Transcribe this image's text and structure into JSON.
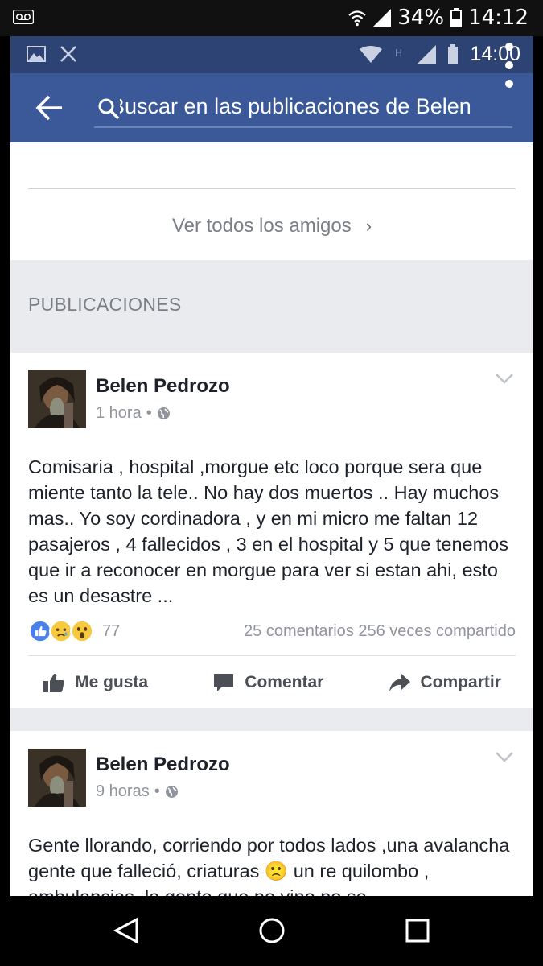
{
  "outer_status": {
    "battery": "34%",
    "time": "14:12"
  },
  "inner_status": {
    "time": "14:00"
  },
  "search": {
    "text": "Buscar en las publicaciones de Belen"
  },
  "friends": {
    "see_all": "Ver todos los amigos"
  },
  "section": {
    "title": "PUBLICACIONES"
  },
  "posts": [
    {
      "author": "Belen Pedrozo",
      "time": "1 hora",
      "separator": "•",
      "text": "Comisaria , hospital ,morgue etc loco porque sera que miente tanto la tele.. No hay dos muertos .. Hay muchos mas.. Yo soy cordinadora , y en mi micro me faltan 12 pasajeros , 4 fallecidos ,  3 en el hospital  y 5 que tenemos que ir a reconocer en morgue para ver si estan ahi, esto es un desastre ...",
      "reactions_count": "77",
      "comments": "25 comentarios",
      "shares": "256 veces compartido"
    },
    {
      "author": "Belen Pedrozo",
      "time": "9 horas",
      "separator": "•",
      "text": "Gente llorando,  corriendo por todos lados ,una avalancha  gente que falleció, criaturas 🙁 un re quilombo , ambulancias, la gente que no vino no se"
    }
  ],
  "actions": {
    "like": "Me gusta",
    "comment": "Comentar",
    "share": "Compartir"
  },
  "colors": {
    "brand": "#3b5998",
    "brand_dark": "#2d4373",
    "feed_bg": "#e9ebee"
  }
}
